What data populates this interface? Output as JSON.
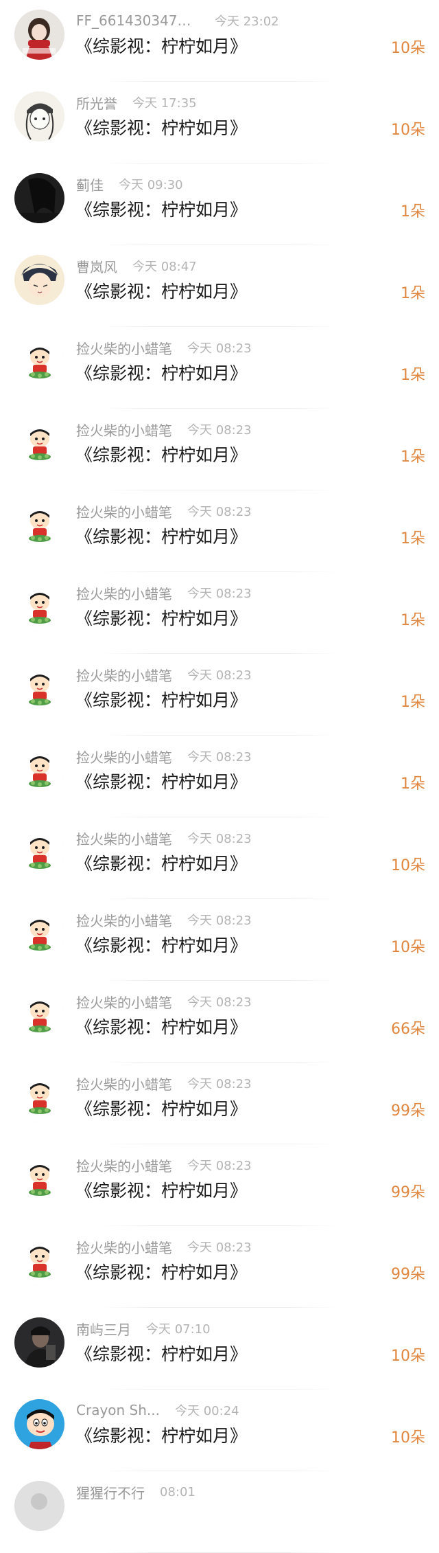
{
  "items": [
    {
      "name": "FF_66143034754...",
      "time": "今天 23:02",
      "title": "《综影视：柠柠如月》",
      "count": "10朵",
      "avatar": "anime-girl-red-scarf"
    },
    {
      "name": "所光誉",
      "time": "今天 17:35",
      "title": "《综影视：柠柠如月》",
      "count": "10朵",
      "avatar": "sketch-girl-cap"
    },
    {
      "name": "蓟佳",
      "time": "今天 09:30",
      "title": "《综影视：柠柠如月》",
      "count": "1朵",
      "avatar": "dark-portrait"
    },
    {
      "name": "曹岚风",
      "time": "今天 08:47",
      "title": "《综影视：柠柠如月》",
      "count": "1朵",
      "avatar": "anime-boy"
    },
    {
      "name": "捡火柴的小蜡笔",
      "time": "今天 08:23",
      "title": "《综影视：柠柠如月》",
      "count": "1朵",
      "avatar": "crayon-kid"
    },
    {
      "name": "捡火柴的小蜡笔",
      "time": "今天 08:23",
      "title": "《综影视：柠柠如月》",
      "count": "1朵",
      "avatar": "crayon-kid"
    },
    {
      "name": "捡火柴的小蜡笔",
      "time": "今天 08:23",
      "title": "《综影视：柠柠如月》",
      "count": "1朵",
      "avatar": "crayon-kid"
    },
    {
      "name": "捡火柴的小蜡笔",
      "time": "今天 08:23",
      "title": "《综影视：柠柠如月》",
      "count": "1朵",
      "avatar": "crayon-kid"
    },
    {
      "name": "捡火柴的小蜡笔",
      "time": "今天 08:23",
      "title": "《综影视：柠柠如月》",
      "count": "1朵",
      "avatar": "crayon-kid"
    },
    {
      "name": "捡火柴的小蜡笔",
      "time": "今天 08:23",
      "title": "《综影视：柠柠如月》",
      "count": "1朵",
      "avatar": "crayon-kid"
    },
    {
      "name": "捡火柴的小蜡笔",
      "time": "今天 08:23",
      "title": "《综影视：柠柠如月》",
      "count": "10朵",
      "avatar": "crayon-kid"
    },
    {
      "name": "捡火柴的小蜡笔",
      "time": "今天 08:23",
      "title": "《综影视：柠柠如月》",
      "count": "10朵",
      "avatar": "crayon-kid"
    },
    {
      "name": "捡火柴的小蜡笔",
      "time": "今天 08:23",
      "title": "《综影视：柠柠如月》",
      "count": "66朵",
      "avatar": "crayon-kid"
    },
    {
      "name": "捡火柴的小蜡笔",
      "time": "今天 08:23",
      "title": "《综影视：柠柠如月》",
      "count": "99朵",
      "avatar": "crayon-kid"
    },
    {
      "name": "捡火柴的小蜡笔",
      "time": "今天 08:23",
      "title": "《综影视：柠柠如月》",
      "count": "99朵",
      "avatar": "crayon-kid"
    },
    {
      "name": "捡火柴的小蜡笔",
      "time": "今天 08:23",
      "title": "《综影视：柠柠如月》",
      "count": "99朵",
      "avatar": "crayon-kid"
    },
    {
      "name": "南屿三月",
      "time": "今天 07:10",
      "title": "《综影视：柠柠如月》",
      "count": "10朵",
      "avatar": "dark-portrait-man"
    },
    {
      "name": "Crayon Sh...",
      "time": "今天 00:24",
      "title": "《综影视：柠柠如月》",
      "count": "10朵",
      "avatar": "crayon-blue"
    },
    {
      "name": "猩猩行不行",
      "time": "08:01",
      "title": "",
      "count": "",
      "avatar": "partial-avatar"
    }
  ],
  "colors": {
    "count": "#e0863f",
    "name": "#9a9a9a",
    "time": "#b4b4b4",
    "title": "#1a1a1a"
  }
}
